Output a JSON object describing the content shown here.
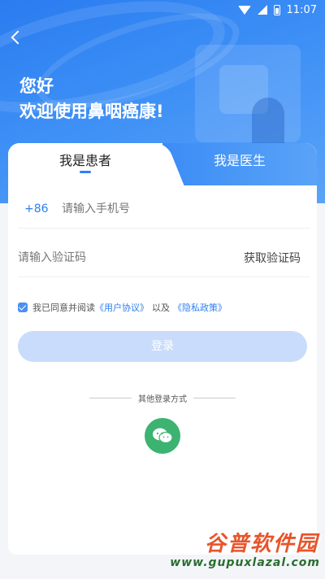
{
  "status_bar": {
    "time": "11:07"
  },
  "header": {
    "greeting": "您好",
    "welcome": "欢迎使用鼻咽癌康!"
  },
  "tabs": [
    {
      "label": "我是患者",
      "active": true
    },
    {
      "label": "我是医生",
      "active": false
    }
  ],
  "form": {
    "country_code": "+86",
    "phone_placeholder": "请输入手机号",
    "code_placeholder": "请输入验证码",
    "get_code_label": "获取验证码"
  },
  "agreement": {
    "checked": true,
    "prefix": "我已同意并阅读",
    "user_agreement": "《用户协议》",
    "and": "以及",
    "privacy_policy": "《隐私政策》"
  },
  "login_button": "登录",
  "other_login": {
    "label": "其他登录方式",
    "icon": "wechat-icon"
  },
  "watermark": {
    "title": "谷普软件园",
    "url": "www.gupuxlazal.com"
  },
  "colors": {
    "primary": "#2f7ff0",
    "login_disabled": "#c9dcfb",
    "wechat": "#3cb371"
  }
}
